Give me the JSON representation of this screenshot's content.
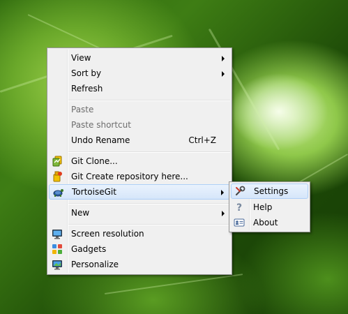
{
  "context_menu": {
    "items": [
      {
        "label": "View"
      },
      {
        "label": "Sort by"
      },
      {
        "label": "Refresh"
      },
      {
        "label": "Paste"
      },
      {
        "label": "Paste shortcut"
      },
      {
        "label": "Undo Rename",
        "shortcut": "Ctrl+Z"
      },
      {
        "label": "Git Clone..."
      },
      {
        "label": "Git Create repository here..."
      },
      {
        "label": "TortoiseGit"
      },
      {
        "label": "New"
      },
      {
        "label": "Screen resolution"
      },
      {
        "label": "Gadgets"
      },
      {
        "label": "Personalize"
      }
    ]
  },
  "submenu": {
    "items": [
      {
        "label": "Settings"
      },
      {
        "label": "Help"
      },
      {
        "label": "About"
      }
    ]
  },
  "colors": {
    "menu_bg": "#f0f0f0",
    "menu_border": "#979797",
    "highlight_bg": "#d6e6fa",
    "highlight_border": "#aecff7",
    "disabled_text": "#6d6d6d"
  }
}
